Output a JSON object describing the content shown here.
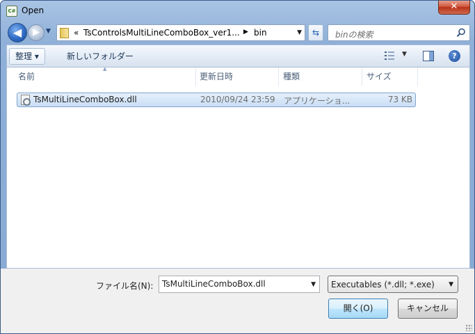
{
  "window": {
    "title": "Open",
    "app_icon_text": "C#",
    "close_glyph": "✕"
  },
  "nav": {
    "back_glyph": "◀",
    "forward_glyph": "▶",
    "dropdown_glyph": "▼",
    "refresh_glyph": "⇆",
    "address": {
      "overflow": "«",
      "crumbs": [
        "TsControlsMultiLineComboBox_ver1...",
        "bin"
      ],
      "separator": "▶"
    },
    "search_placeholder": "binの検索"
  },
  "toolbar": {
    "organize_label": "整理 ▾",
    "new_folder_label": "新しいフォルダー",
    "views_drop": "▼",
    "help_glyph": "?"
  },
  "columns": [
    "名前",
    "更新日時",
    "種類",
    "サイズ"
  ],
  "sort_glyph": "▲",
  "files": [
    {
      "name": "TsMultiLineComboBox.dll",
      "modified": "2010/09/24 23:59",
      "type": "アプリケーショ...",
      "size": "73 KB"
    }
  ],
  "footer": {
    "filename_label": "ファイル名(N):",
    "filename_value": "TsMultiLineComboBox.dll",
    "filetype_value": "Executables (*.dll; *.exe)",
    "open_label": "開く(O)",
    "cancel_label": "キャンセル",
    "drop_glyph": "▼"
  }
}
